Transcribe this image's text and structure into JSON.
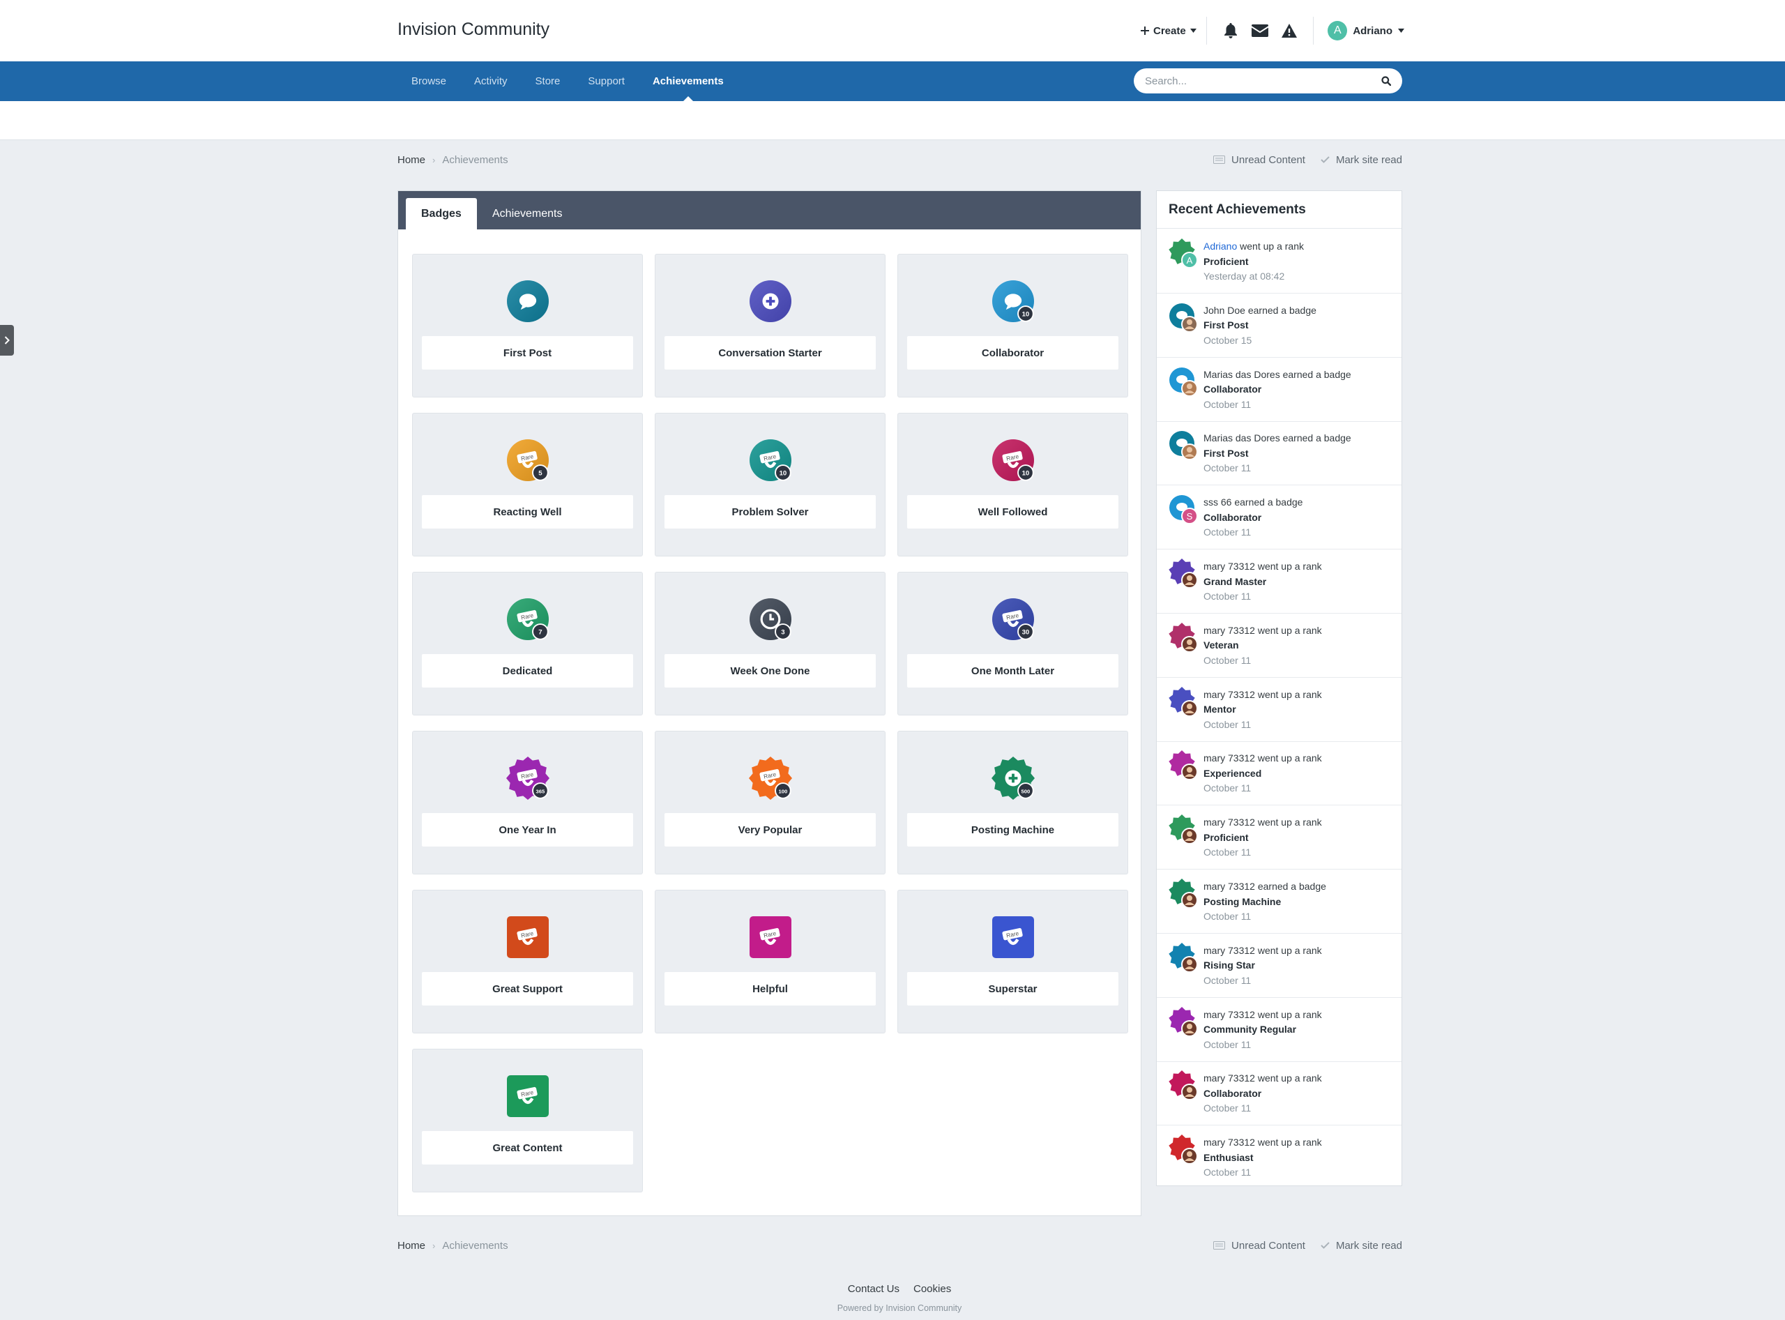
{
  "header": {
    "site_title": "Invision Community",
    "create_label": "Create",
    "user_name": "Adriano",
    "user_initial": "A"
  },
  "nav": {
    "items": [
      {
        "label": "Browse"
      },
      {
        "label": "Activity"
      },
      {
        "label": "Store"
      },
      {
        "label": "Support"
      },
      {
        "label": "Achievements"
      }
    ],
    "active": "Achievements",
    "search_placeholder": "Search..."
  },
  "breadcrumb": {
    "home": "Home",
    "current": "Achievements"
  },
  "quick_links": {
    "unread": "Unread Content",
    "mark_read": "Mark site read"
  },
  "tabs": {
    "badges": "Badges",
    "achievements": "Achievements"
  },
  "badges": [
    {
      "name": "First Post",
      "shape": "circle",
      "color": "#0e7e9c",
      "symbol": "speech",
      "count": ""
    },
    {
      "name": "Conversation Starter",
      "shape": "circle",
      "color": "#4b4bbf",
      "symbol": "plus",
      "count": ""
    },
    {
      "name": "Collaborator",
      "shape": "circle",
      "color": "#1f96d4",
      "symbol": "speech",
      "count": "10"
    },
    {
      "name": "Reacting Well",
      "shape": "circle",
      "color": "#f0a020",
      "symbol": "rare",
      "count": "5"
    },
    {
      "name": "Problem Solver",
      "shape": "circle",
      "color": "#11948f",
      "symbol": "rare",
      "count": "10"
    },
    {
      "name": "Well Followed",
      "shape": "circle",
      "color": "#c2185b",
      "symbol": "rare",
      "count": "10"
    },
    {
      "name": "Dedicated",
      "shape": "circle",
      "color": "#1ea068",
      "symbol": "rare",
      "count": "7"
    },
    {
      "name": "Week One Done",
      "shape": "circle",
      "color": "#3d4654",
      "symbol": "clock",
      "count": "3"
    },
    {
      "name": "One Month Later",
      "shape": "circle",
      "color": "#3346b0",
      "symbol": "rare",
      "count": "30"
    },
    {
      "name": "One Year In",
      "shape": "star",
      "color": "#9b27b0",
      "symbol": "rare",
      "count": "365"
    },
    {
      "name": "Very Popular",
      "shape": "star",
      "color": "#f26b1d",
      "symbol": "rare",
      "count": "100"
    },
    {
      "name": "Posting Machine",
      "shape": "star",
      "color": "#1b8a5f",
      "symbol": "plus",
      "count": "500"
    },
    {
      "name": "Great Support",
      "shape": "square",
      "color": "#d24a1b",
      "symbol": "rare",
      "count": ""
    },
    {
      "name": "Helpful",
      "shape": "square",
      "color": "#c21c8a",
      "symbol": "rare",
      "count": ""
    },
    {
      "name": "Superstar",
      "shape": "square",
      "color": "#3a55d0",
      "symbol": "rare",
      "count": ""
    },
    {
      "name": "Great Content",
      "shape": "square",
      "color": "#1c9a5a",
      "symbol": "rare",
      "count": ""
    }
  ],
  "recent": {
    "title": "Recent Achievements",
    "items": [
      {
        "user": "Adriano",
        "user_link": true,
        "action": "went up a rank",
        "name": "Proficient",
        "date": "Yesterday at 08:42",
        "color": "#2e9a5c",
        "shape": "star",
        "avatar": "#4fbfa7",
        "avatar_letter": "A"
      },
      {
        "user": "John Doe",
        "user_link": false,
        "action": "earned a badge",
        "name": "First Post",
        "date": "October 15",
        "color": "#0e7e9c",
        "shape": "circle",
        "avatar": "#8a6a54",
        "avatar_letter": ""
      },
      {
        "user": "Marias das Dores",
        "user_link": false,
        "action": "earned a badge",
        "name": "Collaborator",
        "date": "October 11",
        "color": "#1f96d4",
        "shape": "circle",
        "avatar": "#b07a52",
        "avatar_letter": ""
      },
      {
        "user": "Marias das Dores",
        "user_link": false,
        "action": "earned a badge",
        "name": "First Post",
        "date": "October 11",
        "color": "#0e7e9c",
        "shape": "circle",
        "avatar": "#b07a52",
        "avatar_letter": ""
      },
      {
        "user": "sss 66",
        "user_link": false,
        "action": "earned a badge",
        "name": "Collaborator",
        "date": "October 11",
        "color": "#1f96d4",
        "shape": "circle",
        "avatar": "#d45087",
        "avatar_letter": "S"
      },
      {
        "user": "mary 73312",
        "user_link": false,
        "action": "went up a rank",
        "name": "Grand Master",
        "date": "October 11",
        "color": "#5a3fb5",
        "shape": "star",
        "avatar": "#6b3a2a",
        "avatar_letter": ""
      },
      {
        "user": "mary 73312",
        "user_link": false,
        "action": "went up a rank",
        "name": "Veteran",
        "date": "October 11",
        "color": "#b0306a",
        "shape": "star",
        "avatar": "#6b3a2a",
        "avatar_letter": ""
      },
      {
        "user": "mary 73312",
        "user_link": false,
        "action": "went up a rank",
        "name": "Mentor",
        "date": "October 11",
        "color": "#4a4fc0",
        "shape": "star",
        "avatar": "#6b3a2a",
        "avatar_letter": ""
      },
      {
        "user": "mary 73312",
        "user_link": false,
        "action": "went up a rank",
        "name": "Experienced",
        "date": "October 11",
        "color": "#b02aa0",
        "shape": "star",
        "avatar": "#6b3a2a",
        "avatar_letter": ""
      },
      {
        "user": "mary 73312",
        "user_link": false,
        "action": "went up a rank",
        "name": "Proficient",
        "date": "October 11",
        "color": "#2e9a5c",
        "shape": "star",
        "avatar": "#6b3a2a",
        "avatar_letter": ""
      },
      {
        "user": "mary 73312",
        "user_link": false,
        "action": "earned a badge",
        "name": "Posting Machine",
        "date": "October 11",
        "color": "#1b8a5f",
        "shape": "star",
        "avatar": "#6b3a2a",
        "avatar_letter": ""
      },
      {
        "user": "mary 73312",
        "user_link": false,
        "action": "went up a rank",
        "name": "Rising Star",
        "date": "October 11",
        "color": "#1282b0",
        "shape": "star",
        "avatar": "#6b3a2a",
        "avatar_letter": ""
      },
      {
        "user": "mary 73312",
        "user_link": false,
        "action": "went up a rank",
        "name": "Community Regular",
        "date": "October 11",
        "color": "#9b27b0",
        "shape": "star",
        "avatar": "#6b3a2a",
        "avatar_letter": ""
      },
      {
        "user": "mary 73312",
        "user_link": false,
        "action": "went up a rank",
        "name": "Collaborator",
        "date": "October 11",
        "color": "#c2185b",
        "shape": "star",
        "avatar": "#6b3a2a",
        "avatar_letter": ""
      },
      {
        "user": "mary 73312",
        "user_link": false,
        "action": "went up a rank",
        "name": "Enthusiast",
        "date": "October 11",
        "color": "#d0282c",
        "shape": "star",
        "avatar": "#6b3a2a",
        "avatar_letter": ""
      }
    ]
  },
  "footer": {
    "contact": "Contact Us",
    "cookies": "Cookies",
    "powered": "Powered by Invision Community"
  }
}
